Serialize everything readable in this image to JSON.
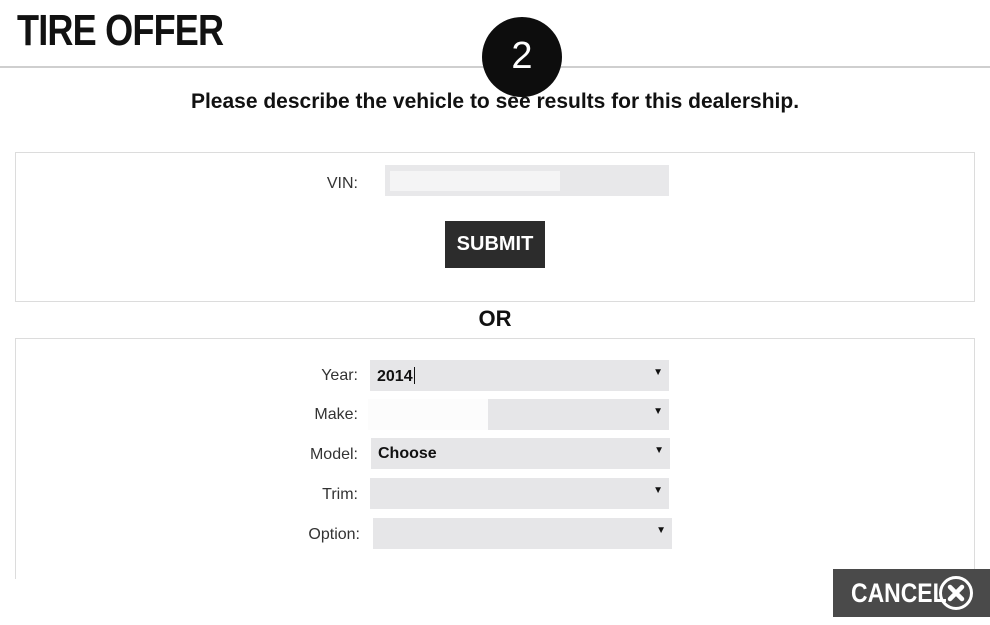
{
  "header": {
    "title": "TIRE OFFER",
    "step_number": "2"
  },
  "instruction": "Please describe the vehicle to see results for this dealership.",
  "vin_section": {
    "label": "VIN:",
    "value": "",
    "submit_label": "SUBMIT"
  },
  "separator": "OR",
  "vehicle_form": {
    "year": {
      "label": "Year:",
      "selected": "2014"
    },
    "make": {
      "label": "Make:",
      "selected": ""
    },
    "model": {
      "label": "Model:",
      "selected": "Choose"
    },
    "trim": {
      "label": "Trim:",
      "selected": ""
    },
    "option": {
      "label": "Option:",
      "selected": ""
    }
  },
  "footer": {
    "cancel_label": "CANCEL",
    "cancel_icon": "close-circle-icon"
  },
  "colors": {
    "button_dark": "#2c2c2c",
    "cancel_bg": "#4a4a4a",
    "input_bg": "#e6e6e8"
  }
}
